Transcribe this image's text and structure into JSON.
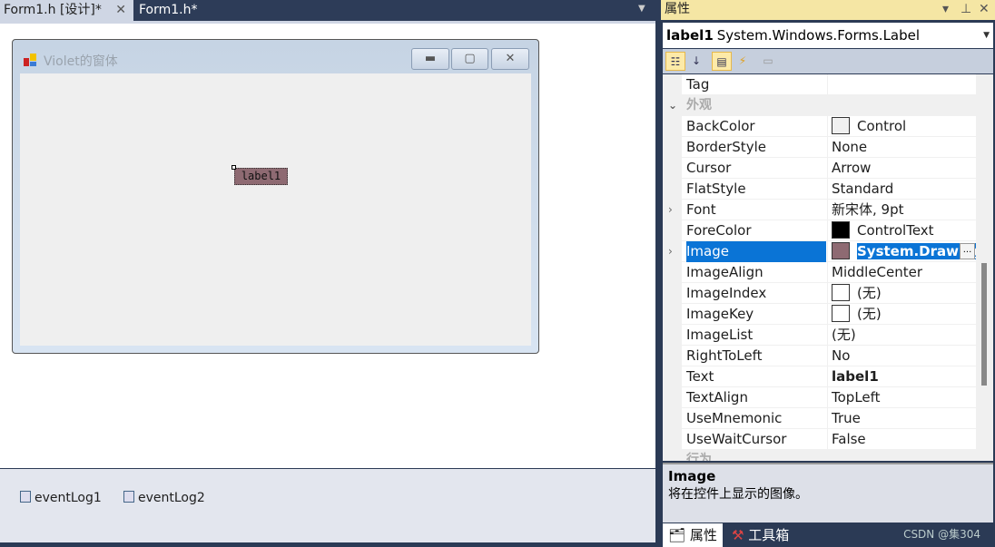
{
  "tabs": [
    {
      "label": "Form1.h [设计]*",
      "active": true
    },
    {
      "label": "Form1.h*",
      "active": false
    }
  ],
  "form": {
    "title": "Violet的窗体",
    "label_text": "label1",
    "buttons": {
      "minimize": "▭",
      "maximize": "▢",
      "close": "✕"
    }
  },
  "tray": [
    "eventLog1",
    "eventLog2"
  ],
  "properties": {
    "title": "属性",
    "object": {
      "name": "label1",
      "type": "System.Windows.Forms.Label"
    },
    "rows": [
      {
        "name": "Tag",
        "value": ""
      },
      {
        "category": "外观"
      },
      {
        "name": "BackColor",
        "value": "Control",
        "swatch": "#f0f0f0"
      },
      {
        "name": "BorderStyle",
        "value": "None"
      },
      {
        "name": "Cursor",
        "value": "Arrow"
      },
      {
        "name": "FlatStyle",
        "value": "Standard"
      },
      {
        "name": "Font",
        "value": "新宋体, 9pt",
        "expandable": true
      },
      {
        "name": "ForeColor",
        "value": "ControlText",
        "swatch": "#000000"
      },
      {
        "name": "Image",
        "value": "System.Drawing.Bitmap",
        "selected": true,
        "expandable": true,
        "swatch": "#8e6a72"
      },
      {
        "name": "ImageAlign",
        "value": "MiddleCenter"
      },
      {
        "name": "ImageIndex",
        "value": "(无)",
        "swatch": "#ffffff"
      },
      {
        "name": "ImageKey",
        "value": "(无)",
        "swatch": "#ffffff"
      },
      {
        "name": "ImageList",
        "value": "(无)"
      },
      {
        "name": "RightToLeft",
        "value": "No"
      },
      {
        "name": "Text",
        "value": "label1",
        "bold": true
      },
      {
        "name": "TextAlign",
        "value": "TopLeft"
      },
      {
        "name": "UseMnemonic",
        "value": "True"
      },
      {
        "name": "UseWaitCursor",
        "value": "False"
      },
      {
        "category": "行为"
      }
    ],
    "description": {
      "title": "Image",
      "text": "将在控件上显示的图像。"
    },
    "bottom_tabs": [
      "属性",
      "工具箱"
    ],
    "watermark": "CSDN @集304"
  }
}
